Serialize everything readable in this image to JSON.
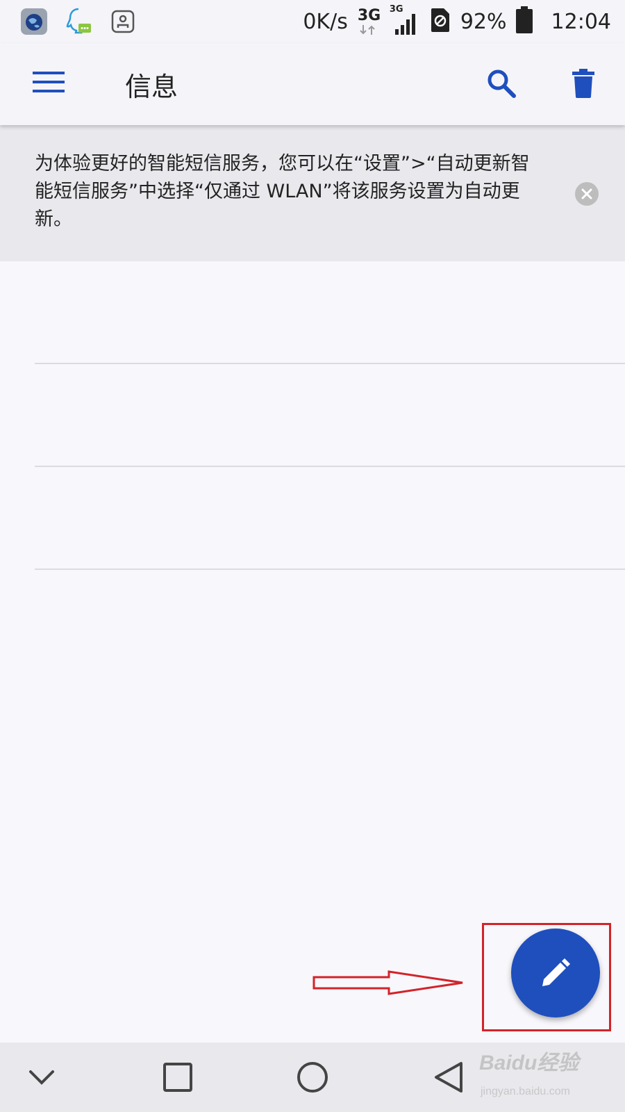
{
  "status_bar": {
    "net_speed": "0K/s",
    "network_type_1": "3G",
    "network_type_2": "3G",
    "battery": "92%",
    "time": "12:04"
  },
  "app_bar": {
    "title": "信息"
  },
  "notice": {
    "text": "为体验更好的智能短信服务，您可以在“设置”>“自动更新智能短信服务”中选择“仅通过 WLAN”将该服务设置为自动更新。"
  },
  "watermark": {
    "brand": "Baidu经验",
    "url": "jingyan.baidu.com"
  },
  "colors": {
    "accent": "#1f4fbd",
    "annotation": "#d2232a"
  }
}
